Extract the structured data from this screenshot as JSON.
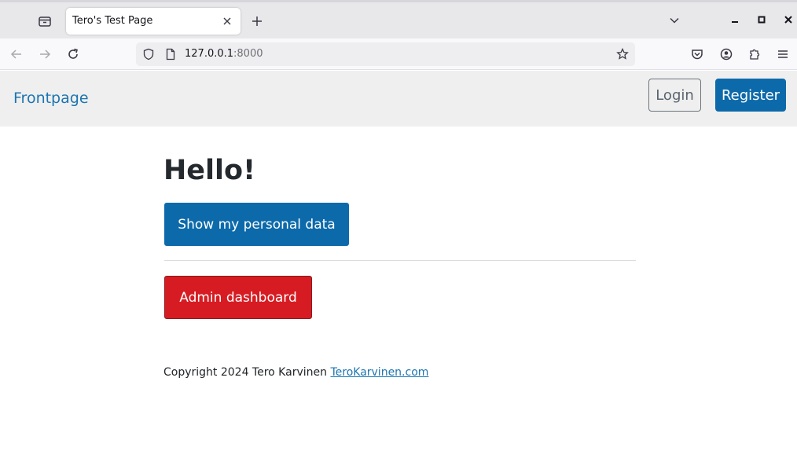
{
  "browser": {
    "tab": {
      "title": "Tero's Test Page"
    },
    "url": {
      "host": "127.0.0.1",
      "port": ":8000"
    }
  },
  "icons": {
    "tab_list": "tab-list-icon",
    "close": "close-icon",
    "new_tab": "plus-icon",
    "back": "back-arrow-icon",
    "forward": "forward-arrow-icon",
    "reload": "reload-icon",
    "shield": "shield-icon",
    "page": "page-icon",
    "star": "star-icon",
    "pocket": "pocket-icon",
    "account": "account-icon",
    "extensions": "puzzle-icon",
    "menu": "hamburger-menu-icon"
  },
  "header": {
    "brand": "Frontpage",
    "login_label": "Login",
    "register_label": "Register"
  },
  "main": {
    "heading": "Hello!",
    "personal_data_label": "Show my personal data",
    "admin_label": "Admin dashboard"
  },
  "footer": {
    "text": "Copyright 2024 Tero Karvinen ",
    "link_text": "TeroKarvinen.com"
  },
  "colors": {
    "primary": "#0d6aaa",
    "danger": "#d61c22",
    "link": "#1c75b0",
    "header_bg": "#efefef"
  }
}
